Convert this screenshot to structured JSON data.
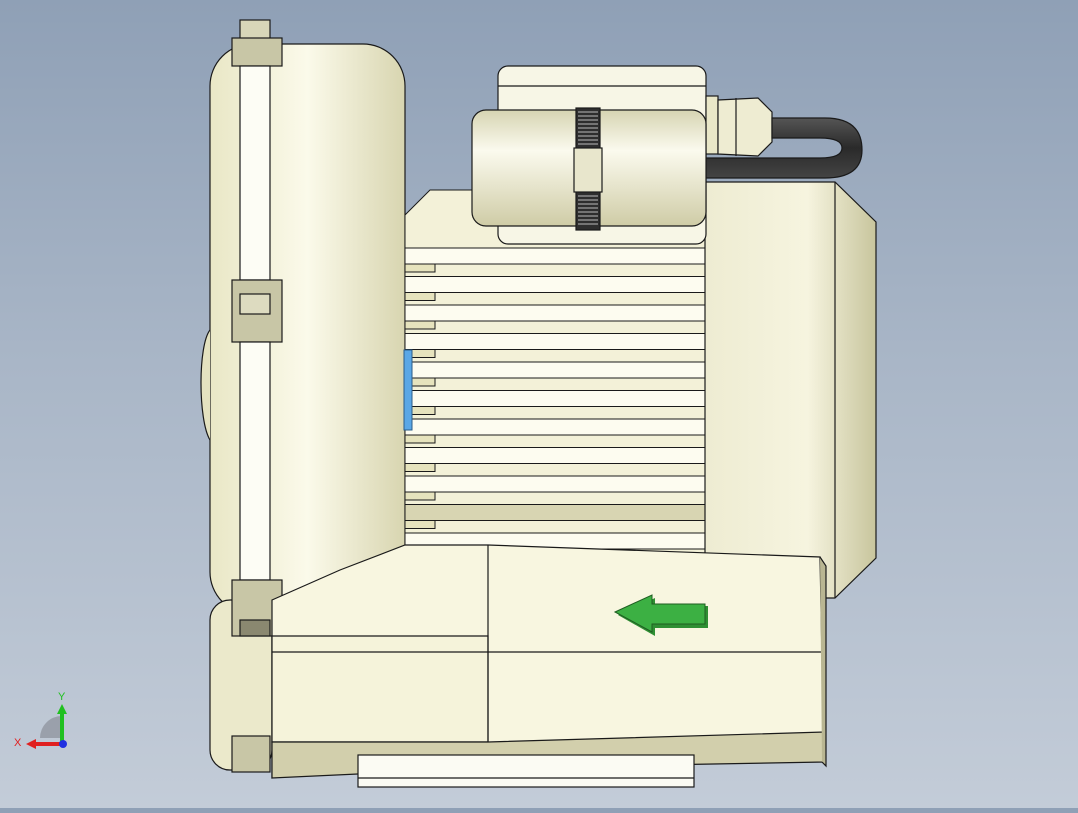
{
  "viewport": {
    "background_top": "#8fa0b6",
    "background_bottom": "#c3ccd8"
  },
  "model": {
    "body_color": "#f5f3dc",
    "shadow_color": "#cfcca8",
    "edge_color": "#1a1a1a",
    "hose_color": "#3a3a3a",
    "arrow_color": "#3cb043",
    "blue_part_color": "#5aa7e6"
  },
  "axis_triad": {
    "x_label": "X",
    "y_label": "Y",
    "x_color": "#e02020",
    "y_color": "#20c020",
    "z_color": "#2030e0"
  },
  "icons": [
    "flow-direction-arrow-icon",
    "axis-triad-icon"
  ]
}
